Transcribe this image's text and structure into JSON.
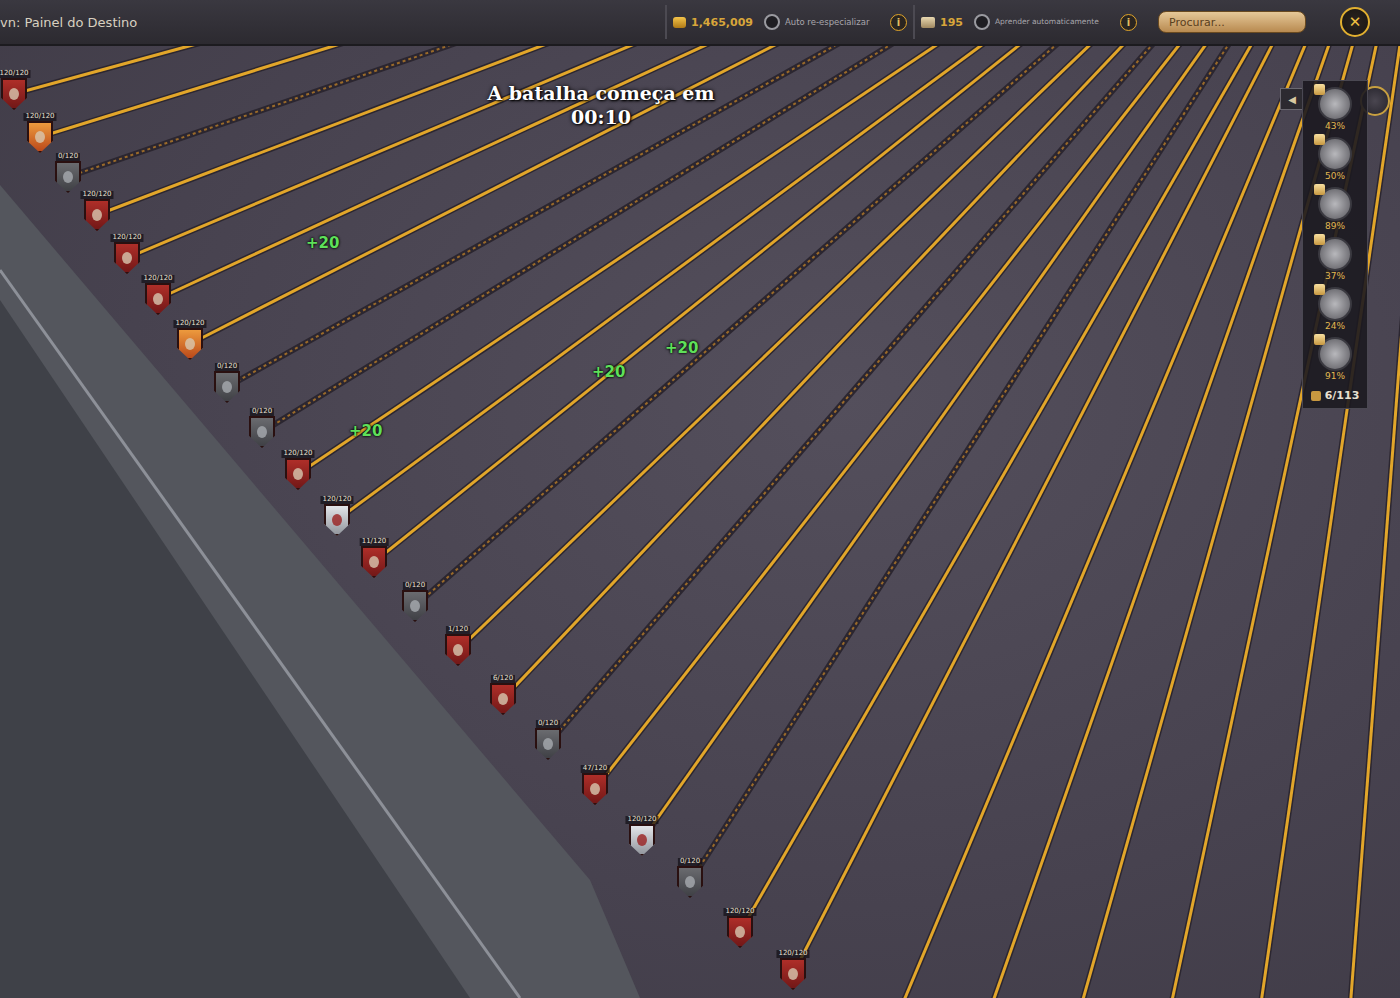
{
  "window": {
    "title": "vn: Painel do Destino",
    "close": "✕"
  },
  "toolbar": {
    "currency": "1,465,009",
    "auto_respec": {
      "label": "Auto re-especializar",
      "on": false,
      "info": "i"
    },
    "points": "195",
    "auto_learn": {
      "label": "Aprender automaticamente",
      "on": false,
      "info": "i"
    }
  },
  "search": {
    "placeholder": "Procurar..."
  },
  "countdown": {
    "label": "A batalha começa em",
    "time": "00:10"
  },
  "nodes": [
    {
      "kind": "red",
      "label": "120/120",
      "learned": true
    },
    {
      "kind": "flame",
      "label": "120/120",
      "learned": true
    },
    {
      "kind": "grey",
      "label": "0/120",
      "learned": false
    },
    {
      "kind": "red",
      "label": "120/120",
      "learned": true
    },
    {
      "kind": "red",
      "label": "120/120",
      "learned": true
    },
    {
      "kind": "red",
      "label": "120/120",
      "learned": true
    },
    {
      "kind": "flame",
      "label": "120/120",
      "learned": true
    },
    {
      "kind": "grey",
      "label": "0/120",
      "learned": false
    },
    {
      "kind": "grey",
      "label": "0/120",
      "learned": false
    },
    {
      "kind": "red",
      "label": "120/120",
      "learned": true
    },
    {
      "kind": "silver",
      "label": "120/120",
      "learned": true
    },
    {
      "kind": "red",
      "label": "11/120",
      "learned": true
    },
    {
      "kind": "grey",
      "label": "0/120",
      "learned": false
    },
    {
      "kind": "red",
      "label": "1/120",
      "learned": true
    },
    {
      "kind": "red",
      "label": "6/120",
      "learned": true
    },
    {
      "kind": "grey",
      "label": "0/120",
      "learned": false
    },
    {
      "kind": "red",
      "label": "47/120",
      "learned": true
    },
    {
      "kind": "silver",
      "label": "120/120",
      "learned": true
    },
    {
      "kind": "grey",
      "label": "0/120",
      "learned": false
    },
    {
      "kind": "red",
      "label": "120/120",
      "learned": true
    },
    {
      "kind": "red",
      "label": "120/120",
      "learned": true
    }
  ],
  "gains": [
    "+20",
    "+20",
    "+20",
    "+20"
  ],
  "tracker": {
    "back": "◀",
    "items": [
      {
        "percent": "43%"
      },
      {
        "percent": "50%"
      },
      {
        "percent": "89%"
      },
      {
        "percent": "37%"
      },
      {
        "percent": "24%"
      },
      {
        "percent": "91%"
      }
    ],
    "count": "6/113"
  }
}
